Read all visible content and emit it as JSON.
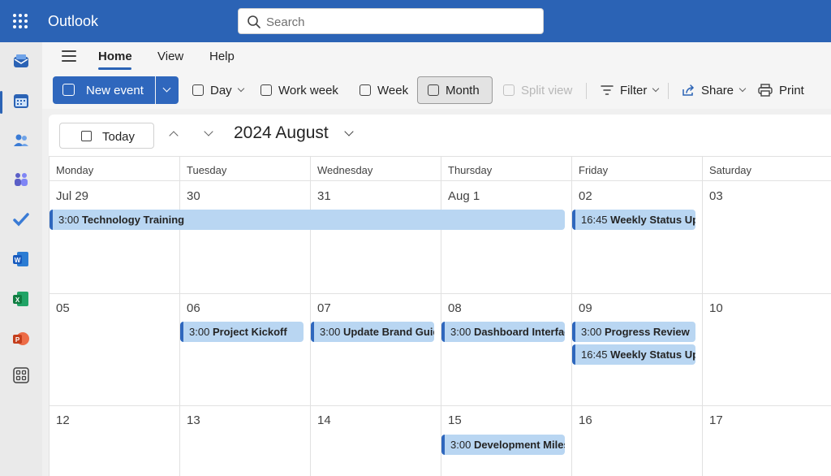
{
  "app": {
    "title": "Outlook",
    "search_placeholder": "Search"
  },
  "rail": {
    "items": [
      {
        "name": "mail-icon",
        "color": "#2b63b5"
      },
      {
        "name": "calendar-icon",
        "color": "#2b63b5"
      },
      {
        "name": "people-icon",
        "color": "#3a7bd5"
      },
      {
        "name": "teams-icon",
        "color": "#5b5fc7"
      },
      {
        "name": "todo-icon",
        "color": "#3a7bd5"
      },
      {
        "name": "word-icon",
        "color": "#185abd"
      },
      {
        "name": "excel-icon",
        "color": "#107c41"
      },
      {
        "name": "powerpoint-icon",
        "color": "#c43e1c"
      },
      {
        "name": "apps-icon",
        "color": "#424242"
      }
    ]
  },
  "menu": {
    "tabs": [
      "Home",
      "View",
      "Help"
    ]
  },
  "toolbar": {
    "new_event": "New event",
    "day": "Day",
    "work_week": "Work week",
    "week": "Week",
    "month": "Month",
    "split_view": "Split view",
    "filter": "Filter",
    "share": "Share",
    "print": "Print"
  },
  "calendar": {
    "today": "Today",
    "month_title": "2024 August",
    "days_of_week": [
      "Monday",
      "Tuesday",
      "Wednesday",
      "Thursday",
      "Friday",
      "Saturday"
    ],
    "weeks": [
      [
        "Jul 29",
        "30",
        "31",
        "Aug 1",
        "02",
        "03"
      ],
      [
        "05",
        "06",
        "07",
        "08",
        "09",
        "10"
      ],
      [
        "12",
        "13",
        "14",
        "15",
        "16",
        "17"
      ]
    ],
    "events": [
      {
        "time": "3:00",
        "title": "Technology Training"
      },
      {
        "time": "16:45",
        "title": "Weekly Status Update"
      },
      {
        "time": "3:00",
        "title": "Project Kickoff"
      },
      {
        "time": "3:00",
        "title": "Update Brand Guidelines"
      },
      {
        "time": "3:00",
        "title": "Dashboard Interface"
      },
      {
        "time": "3:00",
        "title": "Progress Review"
      },
      {
        "time": "16:45",
        "title": "Weekly Status Update"
      },
      {
        "time": "3:00",
        "title": "Development Milestone"
      }
    ]
  }
}
